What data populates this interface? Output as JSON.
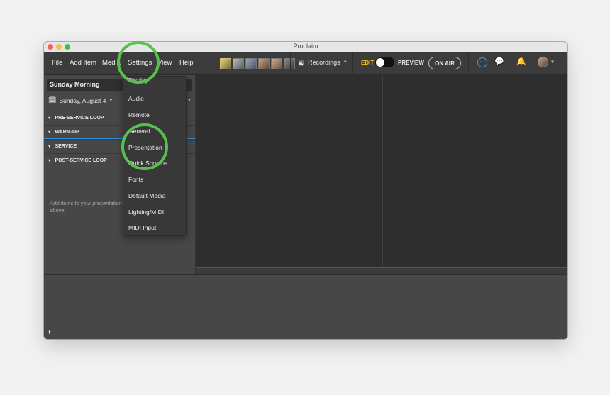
{
  "window": {
    "title": "Proclaim"
  },
  "menu": {
    "file": "File",
    "add_item": "Add Item",
    "media": "Media",
    "settings": "Settings",
    "view": "View",
    "help": "Help"
  },
  "toolbar": {
    "recordings": "Recordings",
    "edit": "EDIT",
    "preview": "PREVIEW",
    "on_air": "ON AIR"
  },
  "sidebar": {
    "service_title": "Sunday Morning",
    "date": "Sunday, August 4",
    "sections": [
      {
        "label": "PRE-SERVICE LOOP"
      },
      {
        "label": "WARM-UP"
      },
      {
        "label": "SERVICE"
      },
      {
        "label": "POST-SERVICE LOOP"
      }
    ],
    "hint": "Add items to your presentation above."
  },
  "settings_menu": {
    "items": [
      "Display",
      "Audio",
      "Remote",
      "General",
      "Presentation",
      "Quick Screens",
      "Fonts",
      "Default Media",
      "Lighting/MIDI",
      "MIDI Input"
    ]
  },
  "colors": {
    "highlight": "#58c04e",
    "edit_label": "#f0c419",
    "accent_blue": "#2f8fe0"
  },
  "icons": [
    "calendar-icon",
    "microphone-icon",
    "play-icon",
    "ellipsis-chat-icon",
    "chat-bubbles-icon",
    "bell-icon",
    "expand-icon"
  ]
}
